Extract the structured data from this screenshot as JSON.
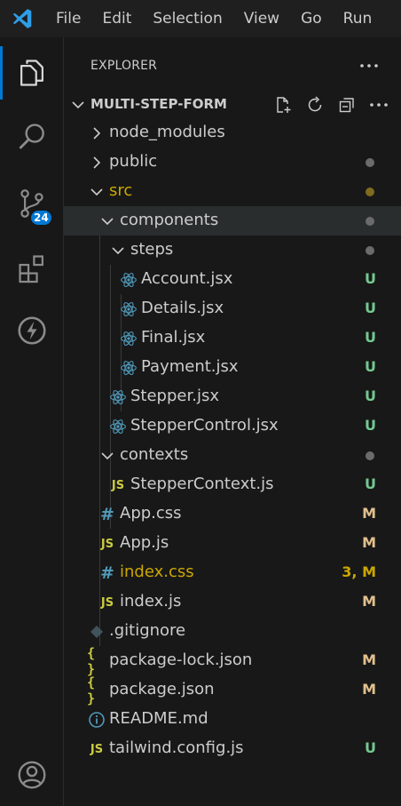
{
  "menu": [
    "File",
    "Edit",
    "Selection",
    "View",
    "Go",
    "Run"
  ],
  "activity": {
    "source_control_badge": "24"
  },
  "explorer": {
    "title": "EXPLORER",
    "project": "MULTI-STEP-FORM"
  },
  "tree": [
    {
      "label": "node_modules",
      "type": "folder",
      "expanded": false,
      "status": ""
    },
    {
      "label": "public",
      "type": "folder",
      "expanded": false,
      "status": "",
      "dot": "gray"
    },
    {
      "label": "src",
      "type": "folder",
      "expanded": true,
      "status": "",
      "dot": "yellow",
      "label_color": "yellow"
    },
    {
      "label": "components",
      "type": "folder",
      "expanded": true,
      "status": "",
      "dot": "gray"
    },
    {
      "label": "steps",
      "type": "folder",
      "expanded": true,
      "status": "",
      "dot": "gray"
    },
    {
      "label": "Account.jsx",
      "type": "react",
      "status": "U"
    },
    {
      "label": "Details.jsx",
      "type": "react",
      "status": "U"
    },
    {
      "label": "Final.jsx",
      "type": "react",
      "status": "U"
    },
    {
      "label": "Payment.jsx",
      "type": "react",
      "status": "U"
    },
    {
      "label": "Stepper.jsx",
      "type": "react",
      "status": "U"
    },
    {
      "label": "StepperControl.jsx",
      "type": "react",
      "status": "U"
    },
    {
      "label": "contexts",
      "type": "folder",
      "expanded": true,
      "status": "",
      "dot": "gray"
    },
    {
      "label": "StepperContext.js",
      "type": "js",
      "status": "U"
    },
    {
      "label": "App.css",
      "type": "css",
      "status": "M"
    },
    {
      "label": "App.js",
      "type": "js",
      "status": "M"
    },
    {
      "label": "index.css",
      "type": "css",
      "status": "3, M",
      "label_color": "yellow"
    },
    {
      "label": "index.js",
      "type": "js",
      "status": "M"
    },
    {
      "label": ".gitignore",
      "type": "git",
      "status": ""
    },
    {
      "label": "package-lock.json",
      "type": "json",
      "status": "M"
    },
    {
      "label": "package.json",
      "type": "json",
      "status": "M"
    },
    {
      "label": "README.md",
      "type": "info",
      "status": ""
    },
    {
      "label": "tailwind.config.js",
      "type": "js",
      "status": "U"
    }
  ],
  "colors": {
    "untracked": "#73c991",
    "modified": "#e2c08d",
    "warning": "#cca700",
    "accent": "#0078d4",
    "react": "#519aba"
  },
  "icons": [
    "vscode-logo-icon",
    "files-icon",
    "search-icon",
    "source-control-icon",
    "extensions-icon",
    "lightning-icon",
    "account-icon"
  ]
}
